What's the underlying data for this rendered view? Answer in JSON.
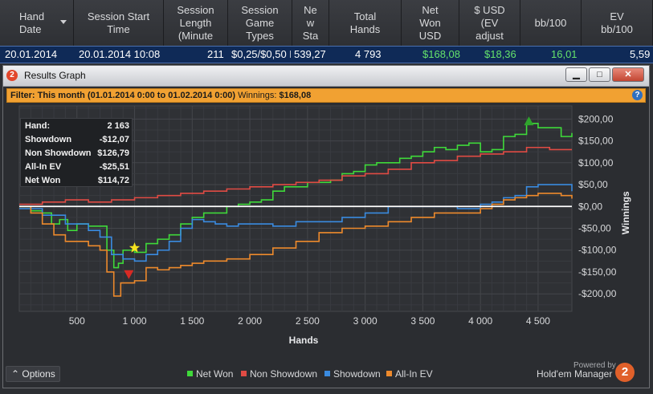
{
  "columns": [
    {
      "label": "Hand\nDate"
    },
    {
      "label": "Session Start\nTime"
    },
    {
      "label": "Session\nLength\n(Minute"
    },
    {
      "label": "Session\nGame\nTypes"
    },
    {
      "label": "Ne\nw\nSta"
    },
    {
      "label": "Total\nHands"
    },
    {
      "label": "Net\nWon\nUSD"
    },
    {
      "label": "$ USD\n(EV\nadjust"
    },
    {
      "label": "bb/100"
    },
    {
      "label": "EV\nbb/100"
    }
  ],
  "row": {
    "date": "20.01.2014",
    "start": "20.01.2014 10:08",
    "length": "211",
    "game": "$0,25/$0,50 N",
    "stake": "539,27",
    "hands": "4 793",
    "netwon": "$168,08",
    "evadj": "$18,36",
    "bb100": "16,01",
    "evbb100": "5,59"
  },
  "window": {
    "title": "Results Graph",
    "logo_number": "2",
    "minimize": "▁",
    "maximize": "□",
    "close": "✕"
  },
  "filter": {
    "prefix": "Filter:",
    "range": "This month (01.01.2014 0:00 to 01.02.2014 0:00)",
    "winnings_label": "Winnings:",
    "winnings_value": "$168,08",
    "help": "?"
  },
  "tooltip": [
    {
      "k": "Hand:",
      "v": "2 163"
    },
    {
      "k": "Showdown",
      "v": "-$12,07"
    },
    {
      "k": "Non Showdown",
      "v": "$126,79"
    },
    {
      "k": "All-In EV",
      "v": "-$25,51"
    },
    {
      "k": "Net Won",
      "v": "$114,72"
    }
  ],
  "chart_data": {
    "type": "line",
    "xlabel": "Hands",
    "ylabel": "Winnings",
    "xlim": [
      0,
      4793
    ],
    "ylim": [
      -240,
      230
    ],
    "xticks": [
      500,
      1000,
      1500,
      2000,
      2500,
      3000,
      3500,
      4000,
      4500
    ],
    "xtick_labels": [
      "500",
      "1 000",
      "1 500",
      "2 000",
      "2 500",
      "3 000",
      "3 500",
      "4 000",
      "4 500"
    ],
    "yticks": [
      200,
      150,
      100,
      50,
      0,
      -50,
      -100,
      -150,
      -200
    ],
    "ytick_labels": [
      "$200,00",
      "$150,00",
      "$100,00",
      "$50,00",
      "$0,00",
      "-$50,00",
      "-$100,00",
      "-$150,00",
      "-$200,00"
    ],
    "series": [
      {
        "name": "Net Won",
        "color": "#3fd93a",
        "x": [
          0,
          100,
          200,
          280,
          350,
          420,
          500,
          600,
          700,
          760,
          820,
          860,
          900,
          1000,
          1100,
          1200,
          1300,
          1400,
          1500,
          1600,
          1700,
          1800,
          1900,
          2000,
          2100,
          2200,
          2300,
          2400,
          2500,
          2600,
          2700,
          2800,
          2900,
          3000,
          3100,
          3200,
          3300,
          3400,
          3500,
          3600,
          3700,
          3800,
          3900,
          4000,
          4100,
          4200,
          4300,
          4400,
          4500,
          4600,
          4700,
          4793
        ],
        "y": [
          0,
          -10,
          -15,
          -40,
          -30,
          -55,
          -40,
          -45,
          -45,
          -100,
          -140,
          -130,
          -100,
          -105,
          -85,
          -75,
          -65,
          -40,
          -25,
          -15,
          -15,
          0,
          5,
          10,
          15,
          35,
          45,
          45,
          55,
          55,
          60,
          75,
          80,
          95,
          100,
          100,
          110,
          115,
          125,
          135,
          130,
          140,
          145,
          125,
          130,
          160,
          165,
          190,
          180,
          180,
          160,
          168
        ]
      },
      {
        "name": "Non Showdown",
        "color": "#e04b44",
        "x": [
          0,
          200,
          400,
          600,
          800,
          1000,
          1200,
          1400,
          1600,
          1800,
          2000,
          2200,
          2400,
          2600,
          2800,
          3000,
          3200,
          3400,
          3600,
          3800,
          4000,
          4200,
          4400,
          4600,
          4793
        ],
        "y": [
          5,
          10,
          15,
          10,
          15,
          20,
          25,
          30,
          35,
          40,
          45,
          50,
          55,
          60,
          70,
          75,
          85,
          100,
          105,
          115,
          120,
          125,
          135,
          130,
          130
        ]
      },
      {
        "name": "Showdown",
        "color": "#3a8be0",
        "x": [
          0,
          200,
          400,
          600,
          700,
          800,
          900,
          1000,
          1100,
          1200,
          1300,
          1400,
          1500,
          1600,
          1700,
          1800,
          1900,
          2000,
          2200,
          2400,
          2600,
          2800,
          3000,
          3200,
          3400,
          3600,
          3800,
          3900,
          4000,
          4100,
          4200,
          4300,
          4400,
          4500,
          4600,
          4793
        ],
        "y": [
          -5,
          -20,
          -40,
          -55,
          -70,
          -110,
          -120,
          -125,
          -110,
          -100,
          -80,
          -50,
          -30,
          -35,
          -40,
          -45,
          -40,
          -40,
          -45,
          -35,
          -35,
          -25,
          -15,
          0,
          0,
          0,
          -5,
          -5,
          5,
          10,
          20,
          25,
          45,
          50,
          50,
          35
        ]
      },
      {
        "name": "All-In EV",
        "color": "#ee8a2c",
        "x": [
          0,
          100,
          200,
          300,
          400,
          500,
          600,
          700,
          760,
          820,
          880,
          1000,
          1100,
          1200,
          1300,
          1400,
          1500,
          1600,
          1800,
          2000,
          2200,
          2400,
          2600,
          2800,
          3000,
          3200,
          3400,
          3600,
          3800,
          4000,
          4100,
          4200,
          4300,
          4400,
          4500,
          4600,
          4700,
          4793
        ],
        "y": [
          0,
          -15,
          -40,
          -65,
          -80,
          -80,
          -90,
          -100,
          -150,
          -205,
          -175,
          -170,
          -140,
          -145,
          -140,
          -135,
          -130,
          -125,
          -120,
          -110,
          -95,
          -80,
          -60,
          -50,
          -45,
          -35,
          -25,
          -15,
          -15,
          -5,
          5,
          15,
          20,
          25,
          30,
          30,
          25,
          18
        ]
      }
    ],
    "markers": [
      {
        "type": "star",
        "color": "#f5e21f",
        "x": 1000,
        "y": -95
      },
      {
        "type": "triangle-down",
        "color": "#d82a24",
        "x": 950,
        "y": -155
      },
      {
        "type": "triangle-up",
        "color": "#2fa42c",
        "x": 4420,
        "y": 195
      }
    ],
    "zero_line": true,
    "grid": true
  },
  "legend": [
    {
      "label": "Net Won",
      "color": "#3fd93a"
    },
    {
      "label": "Non Showdown",
      "color": "#e04b44"
    },
    {
      "label": "Showdown",
      "color": "#3a8be0"
    },
    {
      "label": "All-In EV",
      "color": "#ee8a2c"
    }
  ],
  "footer": {
    "options": "Options",
    "options_icon": "chevron-up-icon",
    "powered": "Powered by",
    "brand": "Hold'em Manager",
    "brand_number": "2"
  }
}
